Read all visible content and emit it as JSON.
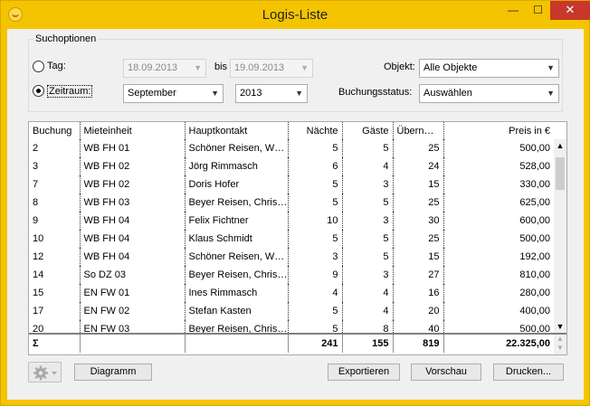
{
  "window": {
    "title": "Logis-Liste",
    "minimize": "—",
    "maximize": "☐",
    "close": "✕"
  },
  "search": {
    "group_label": "Suchoptionen",
    "tag_label": "Tag:",
    "date_from": "18.09.2013",
    "bis_label": "bis",
    "date_to": "19.09.2013",
    "zeitraum_label": "Zeitraum:",
    "month": "September",
    "year": "2013",
    "objekt_label": "Objekt:",
    "objekt_value": "Alle Objekte",
    "status_label": "Buchungsstatus:",
    "status_value": "Auswählen",
    "selected_mode": "Zeitraum"
  },
  "table": {
    "columns": [
      "Buchung",
      "Mieteinheit",
      "Hauptkontakt",
      "Nächte",
      "Gäste",
      "Übern…",
      "Preis in €"
    ],
    "rows": [
      [
        "2",
        "WB FH 01",
        "Schöner Reisen, W…",
        "5",
        "5",
        "25",
        "500,00"
      ],
      [
        "3",
        "WB FH 02",
        "Jörg Rimmasch",
        "6",
        "4",
        "24",
        "528,00"
      ],
      [
        "7",
        "WB FH 02",
        "Doris Hofer",
        "5",
        "3",
        "15",
        "330,00"
      ],
      [
        "8",
        "WB FH 03",
        "Beyer Reisen, Chris…",
        "5",
        "5",
        "25",
        "625,00"
      ],
      [
        "9",
        "WB FH 04",
        "Felix Fichtner",
        "10",
        "3",
        "30",
        "600,00"
      ],
      [
        "10",
        "WB FH 04",
        "Klaus Schmidt",
        "5",
        "5",
        "25",
        "500,00"
      ],
      [
        "12",
        "WB FH 04",
        "Schöner Reisen, W…",
        "3",
        "5",
        "15",
        "192,00"
      ],
      [
        "14",
        "So DZ 03",
        "Beyer Reisen, Chris…",
        "9",
        "3",
        "27",
        "810,00"
      ],
      [
        "15",
        "EN FW 01",
        "Ines Rimmasch",
        "4",
        "4",
        "16",
        "280,00"
      ],
      [
        "17",
        "EN FW 02",
        "Stefan Kasten",
        "5",
        "4",
        "20",
        "400,00"
      ],
      [
        "20",
        "EN FW 03",
        "Beyer Reisen, Chris…",
        "5",
        "8",
        "40",
        "500,00"
      ]
    ],
    "sum": {
      "label": "Σ",
      "naechte": "241",
      "gaeste": "155",
      "uebern": "819",
      "preis": "22.325,00"
    }
  },
  "buttons": {
    "diagramm": "Diagramm",
    "exportieren": "Exportieren",
    "vorschau": "Vorschau",
    "drucken": "Drucken..."
  }
}
